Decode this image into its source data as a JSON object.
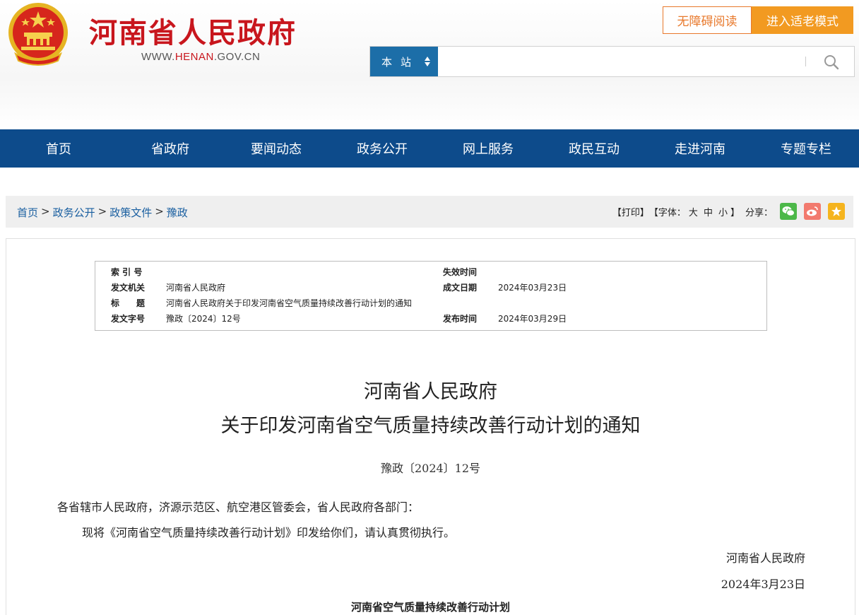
{
  "header": {
    "title": "河南省人民政府",
    "url_prefix": "WWW.",
    "url_highlight": "HENAN",
    "url_suffix": ".GOV.CN",
    "accessibility_label": "无障碍阅读",
    "elder_mode_label": "进入适老模式",
    "search_scope": "本站",
    "search_value": ""
  },
  "nav": [
    "首页",
    "省政府",
    "要闻动态",
    "政务公开",
    "网上服务",
    "政民互动",
    "走进河南",
    "专题专栏"
  ],
  "breadcrumb": {
    "items": [
      "首页",
      "政务公开",
      "政策文件",
      "豫政"
    ],
    "separator": ">"
  },
  "tools": {
    "print": "【打印】",
    "font_label": "【字体：",
    "font_large": "大",
    "font_medium": "中",
    "font_small": "小",
    "font_close": "】",
    "share_label": "分享："
  },
  "meta": {
    "index_label": "索 引 号",
    "index_value": "",
    "expire_label": "失效时间",
    "expire_value": "",
    "issuer_label": "发文机关",
    "issuer_value": "河南省人民政府",
    "created_label": "成文日期",
    "created_value": "2024年03月23日",
    "title_label": "标　　题",
    "title_value": "河南省人民政府关于印发河南省空气质量持续改善行动计划的通知",
    "docno_label": "发文字号",
    "docno_value": "豫政〔2024〕12号",
    "publish_label": "发布时间",
    "publish_value": "2024年03月29日"
  },
  "document": {
    "title_line1": "河南省人民政府",
    "title_line2": "关于印发河南省空气质量持续改善行动计划的通知",
    "doc_number": "豫政〔2024〕12号",
    "addressees": "各省辖市人民政府，济源示范区、航空港区管委会，省人民政府各部门：",
    "body": "现将《河南省空气质量持续改善行动计划》印发给你们，请认真贯彻执行。",
    "signature": "河南省人民政府",
    "date": "2024年3月23日",
    "plan_title": "河南省空气质量持续改善行动计划"
  },
  "colors": {
    "brand_red": "#c8161d",
    "nav_blue": "#0d4b8b",
    "search_blue": "#1c6ea8",
    "accent_orange": "#f29a21"
  },
  "icons": [
    "national-emblem-icon",
    "sort-arrows-icon",
    "search-icon",
    "wechat-icon",
    "weibo-icon",
    "favorite-icon"
  ]
}
